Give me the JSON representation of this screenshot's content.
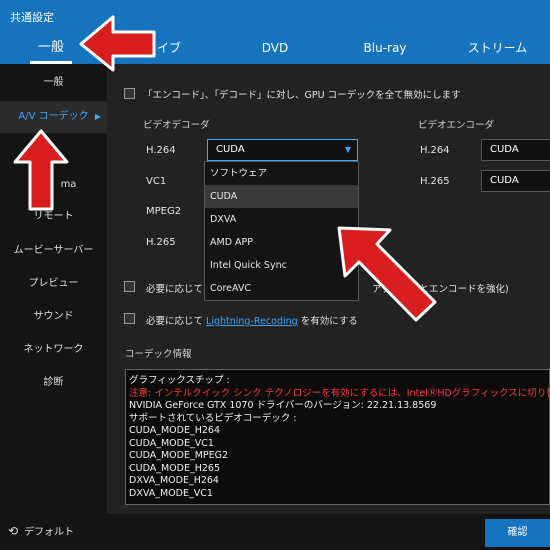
{
  "window": {
    "title": "共通設定"
  },
  "tabs": [
    {
      "label": "一般",
      "active": true
    },
    {
      "label": "ライブ"
    },
    {
      "label": "DVD"
    },
    {
      "label": "Blu-ray"
    },
    {
      "label": "ストリーム"
    }
  ],
  "sidebar": {
    "items": [
      {
        "label": "一般"
      },
      {
        "label": "A/V コーデック",
        "active": true,
        "chevron": "▶"
      },
      {
        "label": "ma"
      },
      {
        "label": "リモート"
      },
      {
        "label": "ムービーサーバー"
      },
      {
        "label": "プレビュー"
      },
      {
        "label": "サウンド"
      },
      {
        "label": "ネットワーク"
      },
      {
        "label": "診断"
      }
    ]
  },
  "content": {
    "disable_gpu_label": "「エンコード」、「デコード」に対し、GPU コーデックを全て無効にします",
    "decoder_header": "ビデオデコーダ",
    "encoder_header": "ビデオエンコーダ",
    "decoders": [
      {
        "label": "H.264",
        "value": "CUDA",
        "open": true
      },
      {
        "label": "VC1"
      },
      {
        "label": "MPEG2"
      },
      {
        "label": "H.265"
      }
    ],
    "encoders": [
      {
        "label": "H.264",
        "value": "CUDA"
      },
      {
        "label": "H.265",
        "value": "CUDA"
      }
    ],
    "dropdown_options": [
      "ソフトウェア",
      "CUDA",
      "DXVA",
      "AMD APP",
      "Intel Quick Sync",
      "CoreAVC"
    ],
    "dropdown_hover_index": 1,
    "option1_prefix": "必要に応じて",
    "option1_link_partial": "L",
    "option1_tail": "アデコードとエンコードを強化)",
    "option2_prefix": "必要に応じて",
    "option2_link": "Lightning-Recoding",
    "option2_suffix": "を有効にする",
    "codec_info_header": "コーデック情報",
    "codec_info_lines": [
      {
        "text": "グラフィックスチップ :"
      },
      {
        "text": "注意: インテルクイック シンク テクノロジーを有効にするには、IntelⓇHDグラフィックスに切り替える必要があります",
        "warn": true
      },
      {
        "text": "NVIDIA GeForce GTX 1070 ドライバーのバージョン: 22.21.13.8569"
      },
      {
        "text": ""
      },
      {
        "text": "サポートされているビデオコーデック :"
      },
      {
        "text": "CUDA_MODE_H264"
      },
      {
        "text": "CUDA_MODE_VC1"
      },
      {
        "text": "CUDA_MODE_MPEG2"
      },
      {
        "text": "CUDA_MODE_H265"
      },
      {
        "text": "DXVA_MODE_H264"
      },
      {
        "text": "DXVA_MODE_VC1"
      }
    ]
  },
  "footer": {
    "default_label": "デフォルト",
    "default_icon": "refresh-icon",
    "ok_label": "確認"
  },
  "colors": {
    "accent": "#1673bd",
    "link": "#3ba7ff",
    "warning": "#ff3b3b",
    "arrow": "#d81e1e"
  }
}
